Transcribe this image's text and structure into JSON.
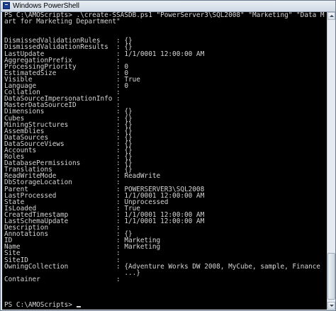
{
  "window": {
    "title": "Windows PowerShell",
    "icon": "powershell-icon"
  },
  "console": {
    "lines": [
      "PS C:\\AMOScripts> .\\create-SSASDB.ps1 \"PowerServer3\\SQL2008\" \"Marketing\" \"Data M",
      "art for Marketing Department\"",
      "",
      "",
      "DismissedValidationRules    : {}",
      "DismissedValidationResults  : {}",
      "LastUpdate                  : 1/1/0001 12:00:00 AM",
      "AggregationPrefix           :",
      "ProcessingPriority          : 0",
      "EstimatedSize               : 0",
      "Visible                     : True",
      "Language                    : 0",
      "Collation                   :",
      "DataSourceImpersonationInfo :",
      "MasterDataSourceID          :",
      "Dimensions                  : {}",
      "Cubes                       : {}",
      "MiningStructures            : {}",
      "Assemblies                  : {}",
      "DataSources                 : {}",
      "DataSourceViews             : {}",
      "Accounts                    : {}",
      "Roles                       : {}",
      "DatabasePermissions         : {}",
      "Translations                : {}",
      "ReadWriteMode               : ReadWrite",
      "DbStorageLocation           :",
      "Parent                      : POWERSERVER3\\SQL2008",
      "LastProcessed               : 1/1/0001 12:00:00 AM",
      "State                       : Unprocessed",
      "IsLoaded                    : True",
      "CreatedTimestamp            : 1/1/0001 12:00:00 AM",
      "LastSchemaUpdate            : 1/1/0001 12:00:00 AM",
      "Description                 :",
      "Annotations                 : {}",
      "ID                          : Marketing",
      "Name                        : Marketing",
      "Site                        :",
      "SiteID                      :",
      "OwningCollection            : {Adventure Works DW 2008, MyCube, sample, Finance",
      "                              ...}",
      "Container                   :",
      "",
      "",
      "",
      "PS C:\\AMOScripts> "
    ]
  },
  "colors": {
    "console_background": "#000000",
    "console_text": "#d6d6d6",
    "titlebar": "#dfe6ee"
  }
}
